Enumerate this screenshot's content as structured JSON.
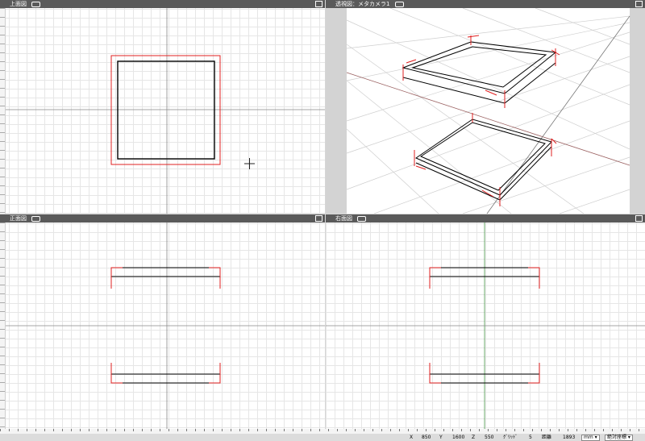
{
  "viewports": {
    "top": {
      "title": "上面図"
    },
    "persp": {
      "title": "透視図：メタカメラ1"
    },
    "front": {
      "title": "正面図"
    },
    "right": {
      "title": "右面図"
    }
  },
  "status": {
    "x_label": "X",
    "x_value": "850",
    "y_label": "Y",
    "y_value": "1600",
    "z_label": "Z",
    "z_value": "550",
    "grid_label": "ｸﾞﾘｯﾄﾞ",
    "grid_value": "5",
    "dist_label": "距離",
    "dist_value": "1893",
    "unit_value": "mm",
    "coord_mode": "絶対座標"
  },
  "icons": [
    "camera-icon",
    "menu-icon",
    "cursor-crosshair-icon",
    "dropdown-arrow-icon"
  ],
  "colors": {
    "header": "#5a5a5a",
    "selection_red": "#e02020",
    "axis": "#888888"
  }
}
